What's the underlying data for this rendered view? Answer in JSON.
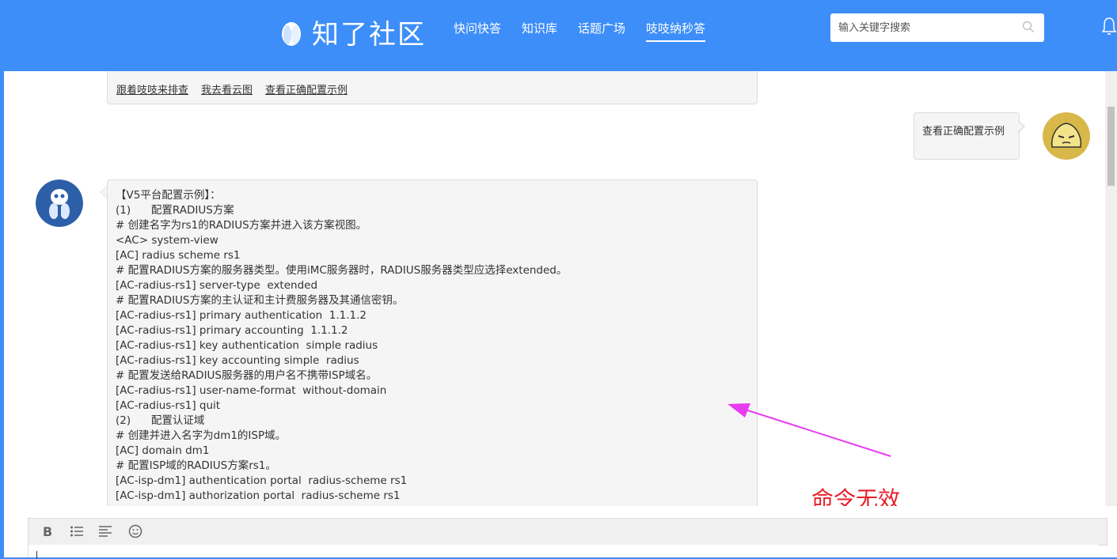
{
  "header": {
    "logo_text": "知了社区",
    "nav": [
      {
        "label": "快问快答",
        "active": false
      },
      {
        "label": "知识库",
        "active": false
      },
      {
        "label": "话题广场",
        "active": false
      },
      {
        "label": "吱吱纳秒答",
        "active": true
      }
    ],
    "search_placeholder": "输入关键字搜索",
    "icons": {
      "search": "search-icon",
      "notifications": "bell-icon"
    }
  },
  "chat": {
    "top_links": [
      "跟着吱吱来排查",
      "我去看云图",
      "查看正确配置示例"
    ],
    "user_message": "查看正确配置示例",
    "bot_message_lines": [
      "【V5平台配置示例】：",
      "(1)      配置RADIUS方案",
      "# 创建名字为rs1的RADIUS方案并进入该方案视图。",
      "<AC> system-view",
      "[AC] radius scheme rs1",
      "# 配置RADIUS方案的服务器类型。使用iMC服务器时，RADIUS服务器类型应选择extended。",
      "[AC-radius-rs1] server-type  extended",
      "# 配置RADIUS方案的主认证和主计费服务器及其通信密钥。",
      "[AC-radius-rs1] primary authentication  1.1.1.2",
      "[AC-radius-rs1] primary accounting  1.1.1.2",
      "[AC-radius-rs1] key authentication  simple radius",
      "[AC-radius-rs1] key accounting simple  radius",
      "# 配置发送给RADIUS服务器的用户名不携带ISP域名。",
      "[AC-radius-rs1] user-name-format  without-domain",
      "[AC-radius-rs1] quit",
      "(2)      配置认证域",
      "# 创建并进入名字为dm1的ISP域。",
      "[AC] domain dm1",
      "# 配置ISP域的RADIUS方案rs1。",
      "[AC-isp-dm1] authentication portal  radius-scheme rs1",
      "[AC-isp-dm1] authorization portal  radius-scheme rs1"
    ],
    "annotation": "命令无效",
    "annotation_color": "#e8202a",
    "arrow_color": "#e83cf0"
  },
  "editor": {
    "toolbar": [
      "bold-icon",
      "list-icon",
      "align-icon",
      "emoji-icon"
    ],
    "bold_label": "B"
  },
  "colors": {
    "brand": "#3d8ef8",
    "bubble": "#f5f5f5"
  }
}
